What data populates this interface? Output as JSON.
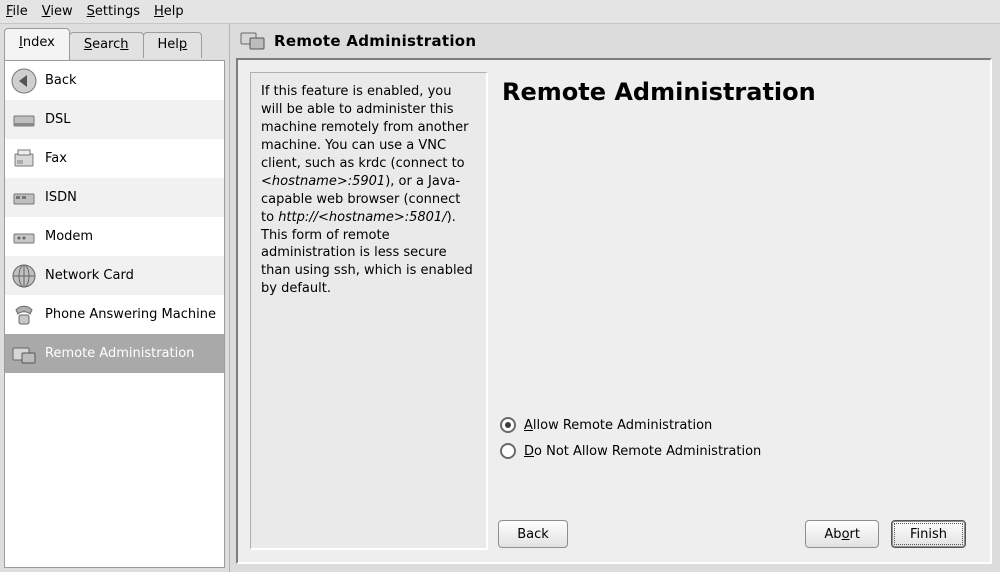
{
  "menubar": {
    "file": "File",
    "view": "View",
    "settings": "Settings",
    "help": "Help"
  },
  "left": {
    "tabs": {
      "index": "Index",
      "search": "Search",
      "help": "Help"
    },
    "items": [
      {
        "label": "Back"
      },
      {
        "label": "DSL"
      },
      {
        "label": "Fax"
      },
      {
        "label": "ISDN"
      },
      {
        "label": "Modem"
      },
      {
        "label": "Network Card"
      },
      {
        "label": "Phone Answering Machine"
      },
      {
        "label": "Remote Administration"
      }
    ]
  },
  "title": "Remote Administration",
  "help_text_parts": {
    "p1": "If this feature is enabled, you will be able to administer this machine remotely from another machine. You can use a VNC client, such as krdc (connect to ",
    "host1": "<hostname>:5901",
    "p2": "), or a Java-capable web browser (connect to ",
    "host2": "http://<hostname>:5801/",
    "p3": "). This form of remote administration is less secure than using ssh, which is enabled by default."
  },
  "heading": "Remote Administration",
  "radios": {
    "allow": "Allow Remote Administration",
    "deny": "Do Not Allow Remote Administration",
    "selected": "allow"
  },
  "buttons": {
    "back": "Back",
    "abort": "Abort",
    "finish": "Finish"
  }
}
